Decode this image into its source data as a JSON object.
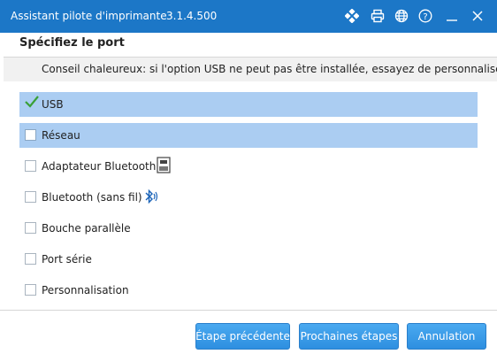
{
  "window": {
    "title": "Assistant pilote d'imprimante",
    "version": "3.1.4.500"
  },
  "titlebar_icons": [
    "move-icon",
    "printer-icon",
    "globe-icon",
    "help-icon",
    "minimize-icon",
    "close-icon"
  ],
  "header": {
    "label": "Spécifiez le port",
    "hint": "Conseil chaleureux: si l'option USB ne peut pas être installée, essayez de personnaliser l"
  },
  "ports": [
    {
      "label": "USB",
      "checked": true,
      "selected": true,
      "icon": null
    },
    {
      "label": "Réseau",
      "checked": false,
      "selected": true,
      "icon": null
    },
    {
      "label": "Adaptateur Bluetooth",
      "checked": false,
      "selected": false,
      "icon": "bluetooth-adapter-icon"
    },
    {
      "label": "Bluetooth (sans fil)",
      "checked": false,
      "selected": false,
      "icon": "bluetooth-icon"
    },
    {
      "label": "Bouche parallèle",
      "checked": false,
      "selected": false,
      "icon": null
    },
    {
      "label": "Port série",
      "checked": false,
      "selected": false,
      "icon": null
    },
    {
      "label": "Personnalisation",
      "checked": false,
      "selected": false,
      "icon": null
    }
  ],
  "footer": {
    "back_label": "Étape précédente",
    "next_label": "Prochaines étapes",
    "cancel_label": "Annulation"
  },
  "colors": {
    "titlebar": "#1c77c7",
    "selection": "#abcdf2",
    "button": "#3498e6",
    "checkmark": "#3aa037"
  }
}
